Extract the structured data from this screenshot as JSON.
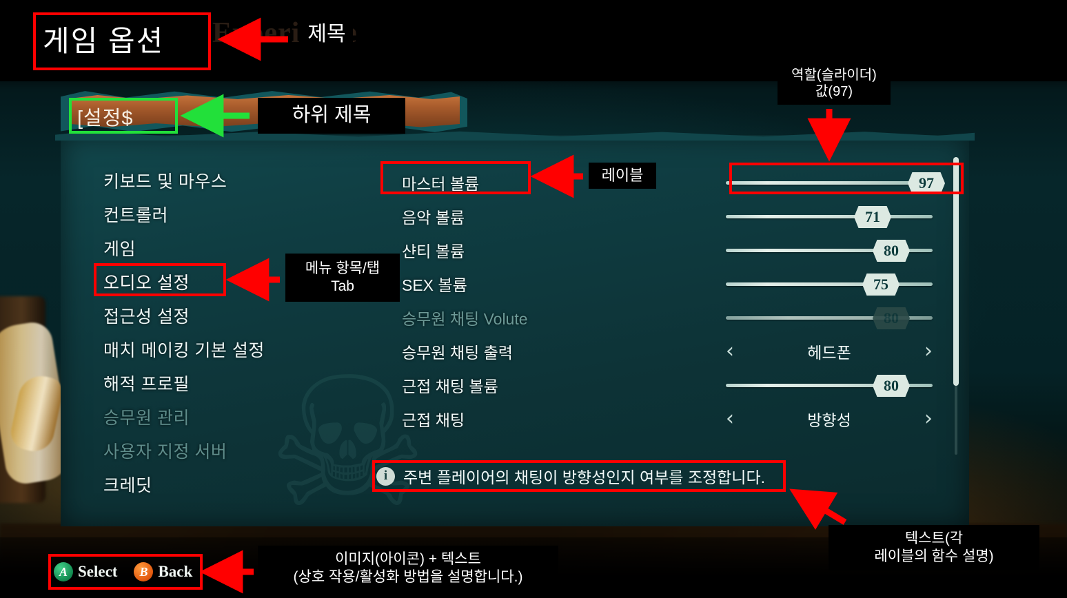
{
  "scene": {
    "background_word": "Experience",
    "panel_color": "#10383c",
    "accent_color": "#ff0000",
    "accent_color_secondary": "#22e03a"
  },
  "game_title": "게임 옵션",
  "sub_title": "[설정$",
  "sidebar": {
    "items": [
      {
        "label": "키보드 및 마우스",
        "state": "normal"
      },
      {
        "label": "컨트롤러",
        "state": "normal"
      },
      {
        "label": "게임",
        "state": "normal"
      },
      {
        "label": "오디오 설정",
        "state": "selected"
      },
      {
        "label": "접근성 설정",
        "state": "normal"
      },
      {
        "label": "매치 메이킹 기본 설정",
        "state": "normal"
      },
      {
        "label": "해적 프로필",
        "state": "normal"
      },
      {
        "label": "승무원 관리",
        "state": "dim"
      },
      {
        "label": "사용자 지정 서버",
        "state": "dim"
      },
      {
        "label": "크레딧",
        "state": "normal"
      }
    ]
  },
  "settings": {
    "rows": [
      {
        "label": "마스터 볼륨",
        "type": "slider",
        "value": "97",
        "percent": 97,
        "state": "normal"
      },
      {
        "label": "음악 볼륨",
        "type": "slider",
        "value": "71",
        "percent": 71,
        "state": "normal"
      },
      {
        "label": "샨티 볼륨",
        "type": "slider",
        "value": "80",
        "percent": 80,
        "state": "normal"
      },
      {
        "label": "SEX 볼륨",
        "type": "slider",
        "value": "75",
        "percent": 75,
        "state": "normal"
      },
      {
        "label": "승무원 채팅 Volute",
        "type": "slider",
        "value": "80",
        "percent": 80,
        "state": "disabled"
      },
      {
        "label": "승무원 채팅 출력",
        "type": "stepper",
        "value": "헤드폰",
        "state": "normal"
      },
      {
        "label": "근접 채팅 볼륨",
        "type": "slider",
        "value": "80",
        "percent": 80,
        "state": "normal"
      },
      {
        "label": "근접 채팅",
        "type": "stepper",
        "value": "방향성",
        "state": "normal"
      }
    ],
    "stepper_prev_icon": "‹",
    "stepper_next_icon": "›"
  },
  "info": {
    "icon": "info-icon",
    "icon_glyph": "i",
    "text": "주변 플레이어의 채팅이 방향성인지 여부를 조정합니다."
  },
  "prompts": [
    {
      "button": "A",
      "label": "Select",
      "color": "#1ea85f"
    },
    {
      "button": "B",
      "label": "Back",
      "color": "#e2590e"
    }
  ],
  "annotations": {
    "title": "제목",
    "sub_title": "하위 제목",
    "menu_tab_line1": "메뉴 항목/탭",
    "menu_tab_line2": "Tab",
    "label": "레이블",
    "slider_line1": "역할(슬라이더)",
    "slider_line2": "값(97)",
    "text_line1": "텍스트(각",
    "text_line2": "레이블의 함수 설명)",
    "image_text_line1": "이미지(아이콘) + 텍스트",
    "image_text_line2": "(상호 작용/활성화 방법을 설명합니다.)"
  }
}
